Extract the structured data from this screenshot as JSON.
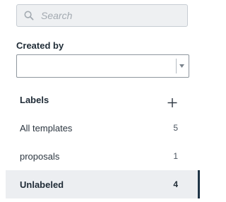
{
  "search": {
    "placeholder": "Search",
    "value": ""
  },
  "created_by": {
    "label": "Created by",
    "selected": ""
  },
  "labels": {
    "heading": "Labels",
    "items": [
      {
        "name": "All templates",
        "count": "5",
        "selected": false
      },
      {
        "name": "proposals",
        "count": "1",
        "selected": false
      },
      {
        "name": "Unlabeled",
        "count": "4",
        "selected": true
      }
    ]
  },
  "colors": {
    "selected_bg": "#eceef1",
    "selected_indicator": "#1f3446",
    "search_bg": "#eef0f2"
  }
}
